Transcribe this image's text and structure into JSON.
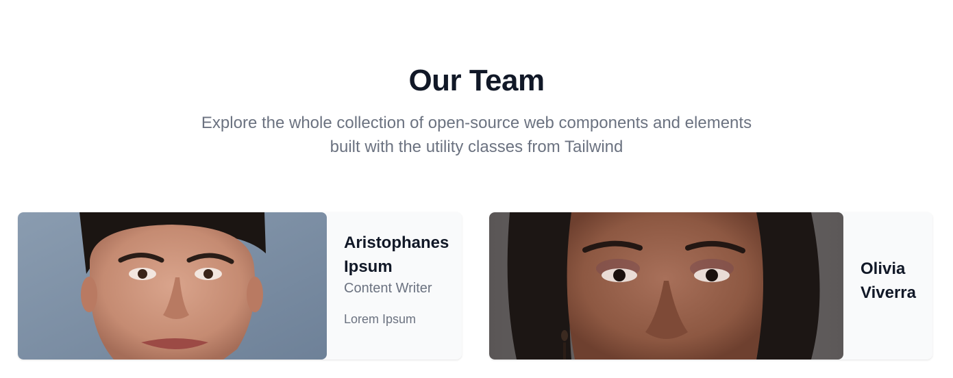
{
  "section": {
    "title": "Our Team",
    "subtitle_line1": "Explore the whole collection of open-source web components and elements",
    "subtitle_line2": "built with the utility classes from Tailwind"
  },
  "members": [
    {
      "name_line1": "Aristophanes",
      "name_line2": "Ipsum",
      "role": "Content Writer",
      "description": "Lorem Ipsum"
    },
    {
      "name_line1": "Olivia",
      "name_line2": "Viverra"
    }
  ],
  "colors": {
    "heading": "#111827",
    "muted": "#6b7280",
    "card_bg": "#f9fafb",
    "page_bg": "#ffffff"
  }
}
